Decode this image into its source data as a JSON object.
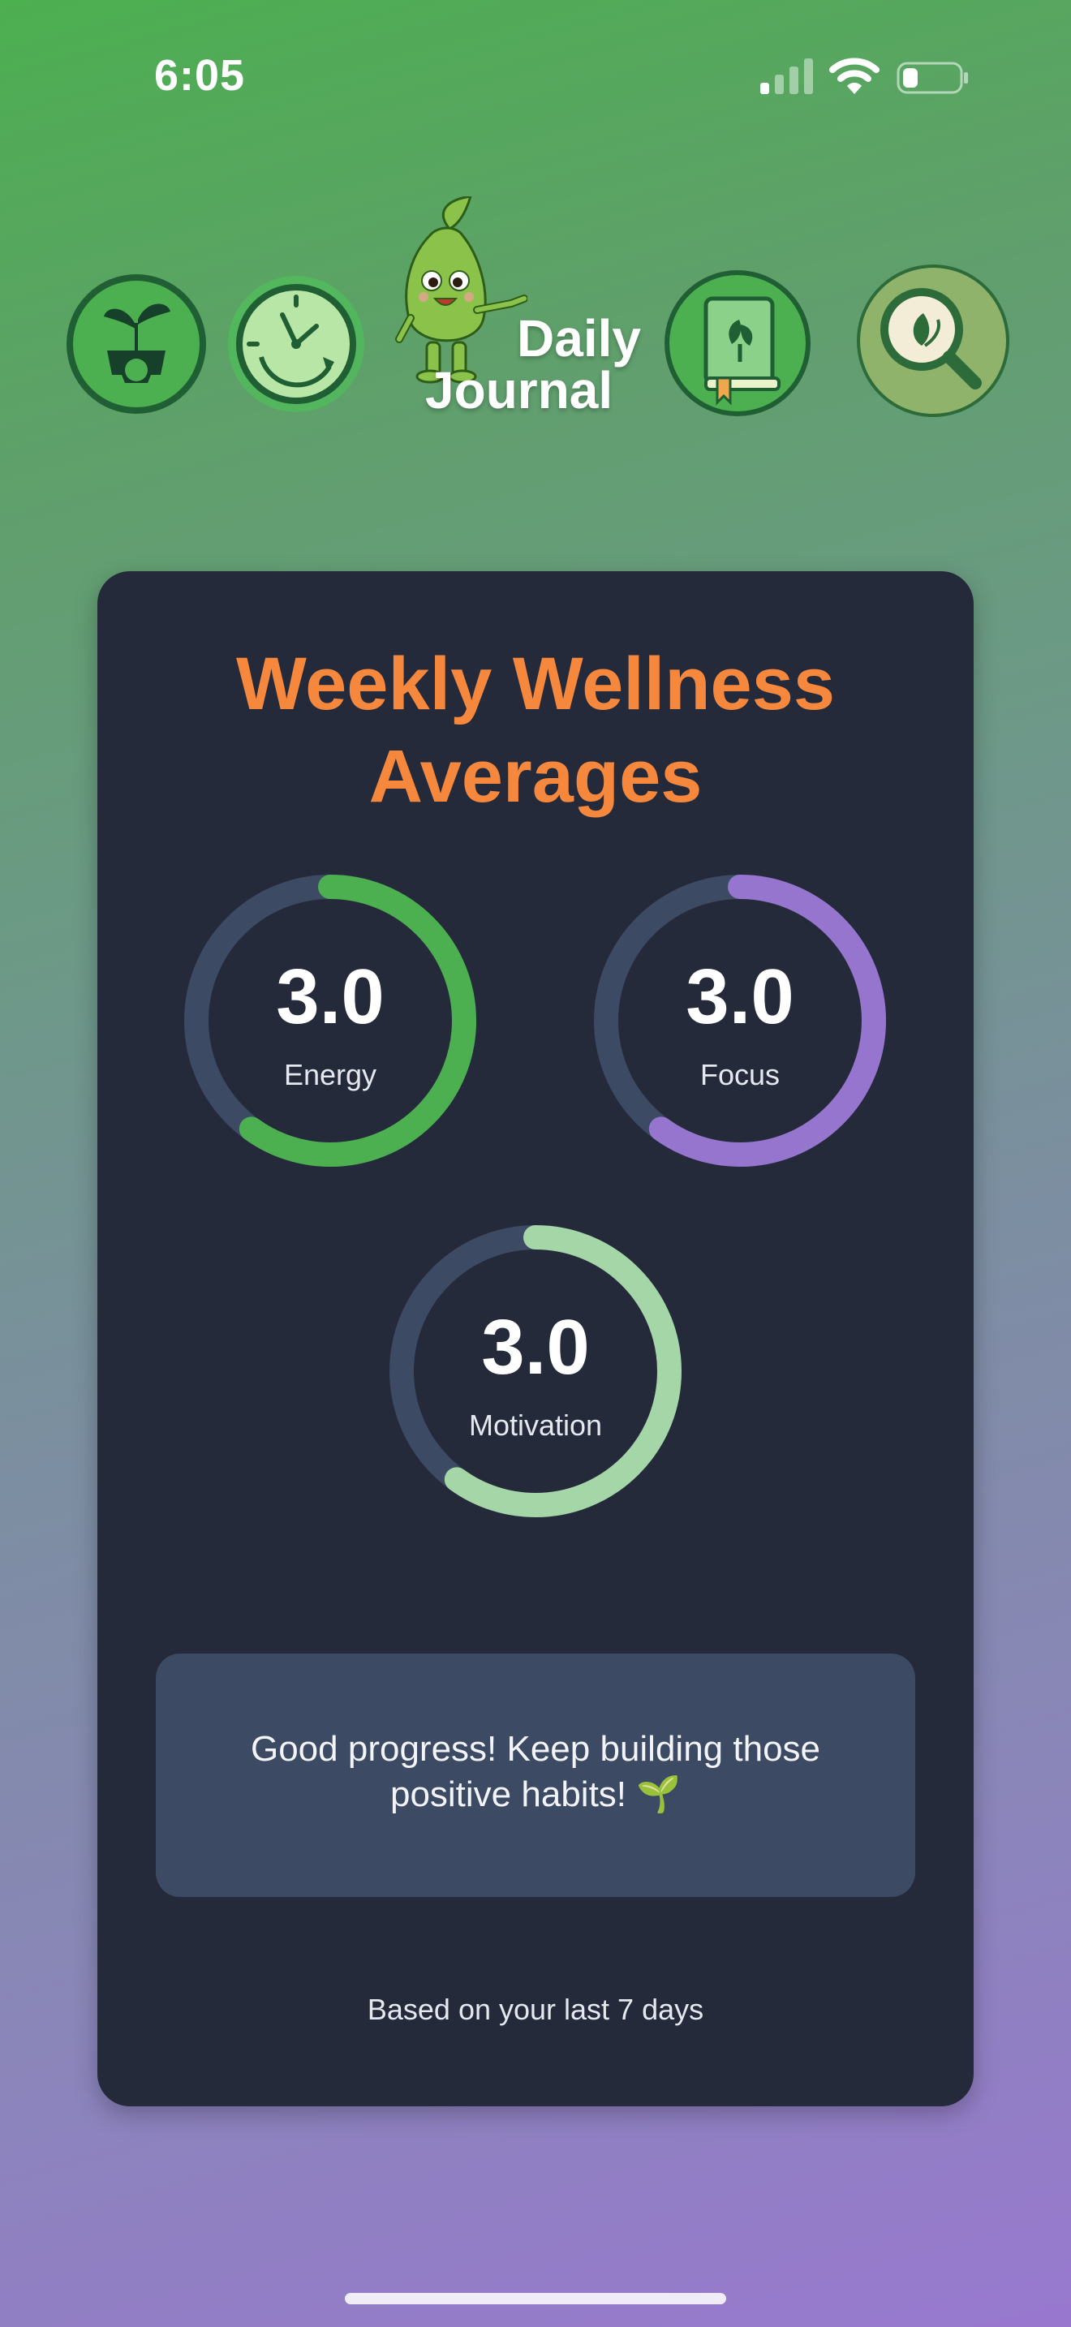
{
  "status_bar": {
    "time": "6:05"
  },
  "header": {
    "brand_line1": "Daily",
    "brand_line2": "Journal",
    "icons": [
      "plant-gear-icon",
      "clock-icon",
      "mascot-icon",
      "journal-book-icon",
      "magnifier-leaf-icon"
    ]
  },
  "card": {
    "title_line1": "Weekly Wellness",
    "title_line2": "Averages",
    "metrics": [
      {
        "label": "Energy",
        "value": "3.0",
        "progress": 0.6,
        "color": "#4caf50"
      },
      {
        "label": "Focus",
        "value": "3.0",
        "progress": 0.6,
        "color": "#9575cd"
      },
      {
        "label": "Motivation",
        "value": "3.0",
        "progress": 0.6,
        "color": "#a5d6a7"
      }
    ],
    "message": "Good progress! Keep building those positive habits! 🌱",
    "footnote": "Based on your last 7 days"
  },
  "colors": {
    "accent": "#f5883c",
    "card_bg": "#252a3b",
    "ring_track": "#3c4a64",
    "message_bg": "#3c4a64"
  }
}
